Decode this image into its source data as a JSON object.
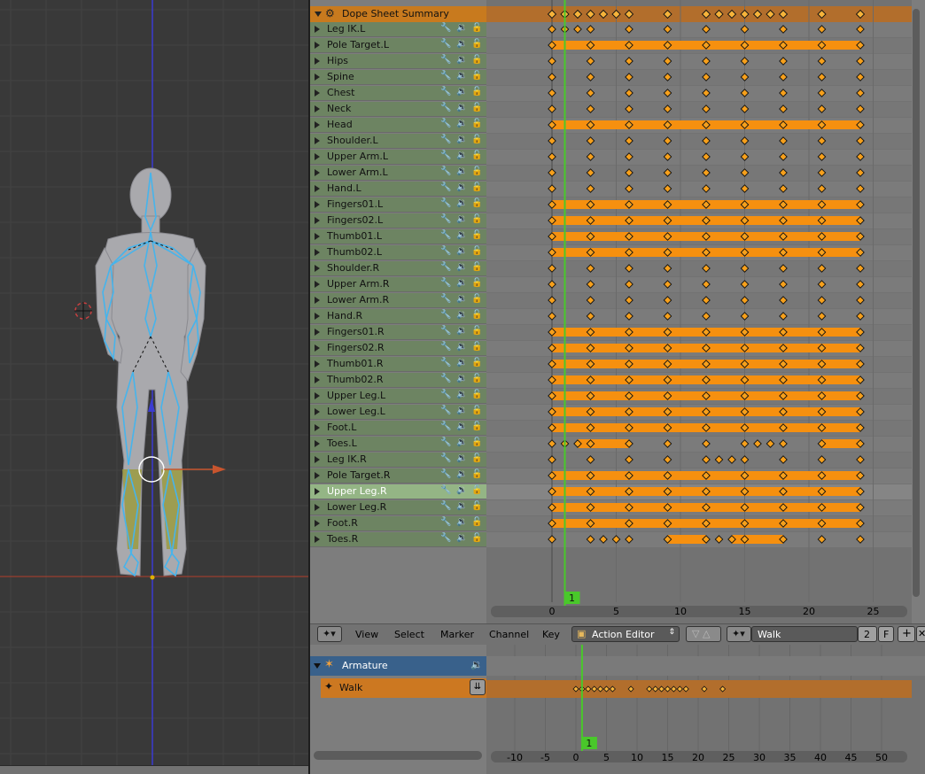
{
  "dopesheet": {
    "summary_label": "Dope Sheet Summary",
    "current_frame": "1",
    "channels": [
      {
        "name": "Leg IK.L",
        "keys": [
          0,
          1,
          2,
          3,
          6,
          9,
          12,
          15,
          18,
          21,
          24
        ],
        "holds": []
      },
      {
        "name": "Pole Target.L",
        "keys": [
          0,
          3,
          6,
          9,
          12,
          15,
          18,
          21,
          24
        ],
        "holds": [
          [
            0,
            24
          ]
        ]
      },
      {
        "name": "Hips",
        "keys": [
          0,
          3,
          6,
          9,
          12,
          15,
          18,
          21,
          24
        ],
        "holds": []
      },
      {
        "name": "Spine",
        "keys": [
          0,
          3,
          6,
          9,
          12,
          15,
          18,
          21,
          24
        ],
        "holds": []
      },
      {
        "name": "Chest",
        "keys": [
          0,
          3,
          6,
          9,
          12,
          15,
          18,
          21,
          24
        ],
        "holds": []
      },
      {
        "name": "Neck",
        "keys": [
          0,
          3,
          6,
          9,
          12,
          15,
          18,
          21,
          24
        ],
        "holds": []
      },
      {
        "name": "Head",
        "keys": [
          0,
          3,
          6,
          9,
          12,
          15,
          18,
          21,
          24
        ],
        "holds": [
          [
            0,
            24
          ]
        ]
      },
      {
        "name": "Shoulder.L",
        "keys": [
          0,
          3,
          6,
          9,
          12,
          15,
          18,
          21,
          24
        ],
        "holds": []
      },
      {
        "name": "Upper Arm.L",
        "keys": [
          0,
          3,
          6,
          9,
          12,
          15,
          18,
          21,
          24
        ],
        "holds": []
      },
      {
        "name": "Lower Arm.L",
        "keys": [
          0,
          3,
          6,
          9,
          12,
          15,
          18,
          21,
          24
        ],
        "holds": []
      },
      {
        "name": "Hand.L",
        "keys": [
          0,
          3,
          6,
          9,
          12,
          15,
          18,
          21,
          24
        ],
        "holds": []
      },
      {
        "name": "Fingers01.L",
        "keys": [
          0,
          3,
          6,
          9,
          12,
          15,
          18,
          21,
          24
        ],
        "holds": [
          [
            0,
            24
          ]
        ]
      },
      {
        "name": "Fingers02.L",
        "keys": [
          0,
          3,
          6,
          9,
          12,
          15,
          18,
          21,
          24
        ],
        "holds": [
          [
            0,
            24
          ]
        ]
      },
      {
        "name": "Thumb01.L",
        "keys": [
          0,
          3,
          6,
          9,
          12,
          15,
          18,
          21,
          24
        ],
        "holds": [
          [
            0,
            24
          ]
        ]
      },
      {
        "name": "Thumb02.L",
        "keys": [
          0,
          3,
          6,
          9,
          12,
          15,
          18,
          21,
          24
        ],
        "holds": [
          [
            0,
            24
          ]
        ]
      },
      {
        "name": "Shoulder.R",
        "keys": [
          0,
          3,
          6,
          9,
          12,
          15,
          18,
          21,
          24
        ],
        "holds": []
      },
      {
        "name": "Upper Arm.R",
        "keys": [
          0,
          3,
          6,
          9,
          12,
          15,
          18,
          21,
          24
        ],
        "holds": []
      },
      {
        "name": "Lower Arm.R",
        "keys": [
          0,
          3,
          6,
          9,
          12,
          15,
          18,
          21,
          24
        ],
        "holds": []
      },
      {
        "name": "Hand.R",
        "keys": [
          0,
          3,
          6,
          9,
          12,
          15,
          18,
          21,
          24
        ],
        "holds": []
      },
      {
        "name": "Fingers01.R",
        "keys": [
          0,
          3,
          6,
          9,
          12,
          15,
          18,
          21,
          24
        ],
        "holds": [
          [
            0,
            24
          ]
        ]
      },
      {
        "name": "Fingers02.R",
        "keys": [
          0,
          3,
          6,
          9,
          12,
          15,
          18,
          21,
          24
        ],
        "holds": [
          [
            0,
            24
          ]
        ]
      },
      {
        "name": "Thumb01.R",
        "keys": [
          0,
          3,
          6,
          9,
          12,
          15,
          18,
          21,
          24
        ],
        "holds": [
          [
            0,
            24
          ]
        ]
      },
      {
        "name": "Thumb02.R",
        "keys": [
          0,
          3,
          6,
          9,
          12,
          15,
          18,
          21,
          24
        ],
        "holds": [
          [
            0,
            24
          ]
        ]
      },
      {
        "name": "Upper Leg.L",
        "keys": [
          0,
          3,
          6,
          9,
          12,
          15,
          18,
          21,
          24
        ],
        "holds": [
          [
            0,
            24
          ]
        ]
      },
      {
        "name": "Lower Leg.L",
        "keys": [
          0,
          3,
          6,
          9,
          12,
          15,
          18,
          21,
          24
        ],
        "holds": [
          [
            0,
            24
          ]
        ]
      },
      {
        "name": "Foot.L",
        "keys": [
          0,
          3,
          6,
          9,
          12,
          15,
          18,
          21,
          24
        ],
        "holds": [
          [
            0,
            24
          ]
        ]
      },
      {
        "name": "Toes.L",
        "keys": [
          0,
          1,
          2,
          3,
          6,
          9,
          12,
          15,
          16,
          17,
          18,
          21,
          24
        ],
        "holds": [
          [
            2,
            6
          ],
          [
            21,
            24
          ]
        ]
      },
      {
        "name": "Leg IK.R",
        "keys": [
          0,
          3,
          6,
          9,
          12,
          13,
          14,
          15,
          18,
          21,
          24
        ],
        "holds": []
      },
      {
        "name": "Pole Target.R",
        "keys": [
          0,
          3,
          6,
          9,
          12,
          15,
          18,
          21,
          24
        ],
        "holds": [
          [
            0,
            24
          ]
        ]
      },
      {
        "name": "Upper Leg.R",
        "keys": [
          0,
          3,
          6,
          9,
          12,
          15,
          18,
          21,
          24
        ],
        "holds": [
          [
            0,
            24
          ]
        ],
        "selected": true
      },
      {
        "name": "Lower Leg.R",
        "keys": [
          0,
          3,
          6,
          9,
          12,
          15,
          18,
          21,
          24
        ],
        "holds": [
          [
            0,
            24
          ]
        ]
      },
      {
        "name": "Foot.R",
        "keys": [
          0,
          3,
          6,
          9,
          12,
          15,
          18,
          21,
          24
        ],
        "holds": [
          [
            0,
            24
          ]
        ]
      },
      {
        "name": "Toes.R",
        "keys": [
          0,
          3,
          4,
          5,
          6,
          9,
          12,
          13,
          14,
          15,
          18,
          21,
          24
        ],
        "holds": [
          [
            9,
            12
          ],
          [
            14,
            18
          ]
        ]
      }
    ],
    "summary_keys": [
      0,
      1,
      2,
      3,
      4,
      5,
      6,
      9,
      12,
      13,
      14,
      15,
      16,
      17,
      18,
      21,
      24
    ],
    "ruler_ticks": [
      "0",
      "5",
      "10",
      "15",
      "20",
      "25"
    ]
  },
  "header": {
    "menus": [
      "View",
      "Select",
      "Marker",
      "Channel",
      "Key"
    ],
    "editor_mode": "Action Editor",
    "action_name": "Walk",
    "action_users": "2",
    "fake_user": "F"
  },
  "nla": {
    "object_label": "Armature",
    "action_label": "Walk",
    "current_frame": "1",
    "ruler_ticks": [
      "-10",
      "-5",
      "0",
      "5",
      "10",
      "15",
      "20",
      "25",
      "30",
      "35",
      "40",
      "45",
      "50"
    ],
    "strip_keys": [
      0,
      1,
      2,
      3,
      4,
      5,
      6,
      9,
      12,
      13,
      14,
      15,
      16,
      17,
      18,
      21,
      24
    ]
  },
  "colors": {
    "accent": "#f6a01c",
    "selection": "#94b585",
    "playhead": "#49c82a"
  }
}
